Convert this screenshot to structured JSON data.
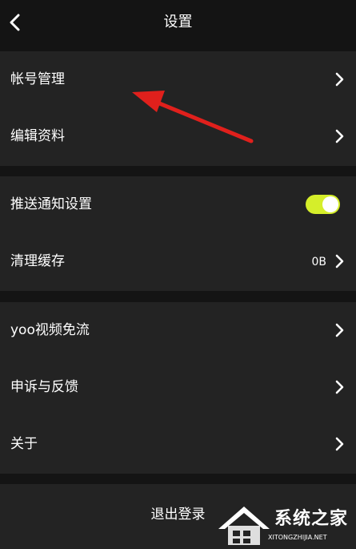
{
  "header": {
    "title": "设置"
  },
  "groups": [
    {
      "items": [
        {
          "label": "帐号管理"
        },
        {
          "label": "编辑资料"
        }
      ]
    },
    {
      "items": [
        {
          "label": "推送通知设置",
          "toggle_on": true
        },
        {
          "label": "清理缓存",
          "value": "0B"
        }
      ]
    },
    {
      "items": [
        {
          "label": "yoo视频免流"
        },
        {
          "label": "申诉与反馈"
        },
        {
          "label": "关于"
        }
      ]
    }
  ],
  "logout": {
    "label": "退出登录"
  },
  "watermark": {
    "text": "系统之家",
    "url": "XITONGZHIJIA.NET"
  },
  "colors": {
    "accent": "#d5ee2a",
    "annotation_arrow": "#e0201c",
    "row_background": "#232323",
    "page_background": "#141414"
  }
}
